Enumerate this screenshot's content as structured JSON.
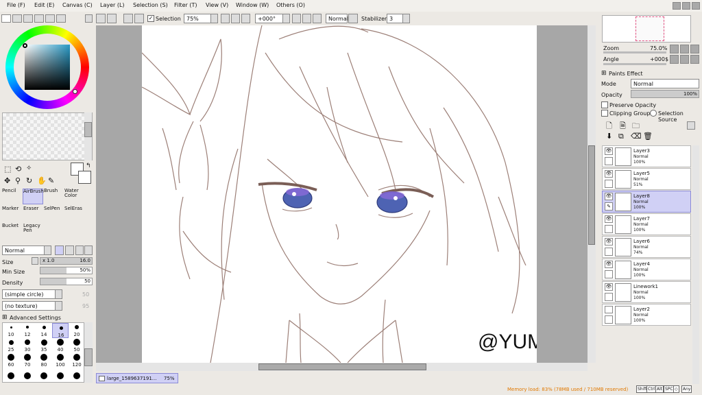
{
  "menu": [
    "File (F)",
    "Edit (E)",
    "Canvas (C)",
    "Layer (L)",
    "Selection (S)",
    "Filter (T)",
    "View (V)",
    "Window (W)",
    "Others (O)"
  ],
  "toolbar": {
    "selection_label": "Selection",
    "zoom": "75%",
    "angle": "+000°",
    "blend_mode": "Normal",
    "stabilizer_label": "Stabilizer",
    "stabilizer_value": "3"
  },
  "tools": [
    {
      "label": "Pencil"
    },
    {
      "label": "AirBrush"
    },
    {
      "label": "Brush"
    },
    {
      "label": "Water Color"
    },
    {
      "label": "Marker"
    },
    {
      "label": "Eraser"
    },
    {
      "label": "SelPen"
    },
    {
      "label": "SelEras"
    },
    {
      "label": "Bucket"
    },
    {
      "label": "Legacy Pen"
    }
  ],
  "brush": {
    "mode": "Normal",
    "size_label": "Size",
    "size_mult": "x 1.0",
    "size_value": "16.0",
    "min_size_label": "Min Size",
    "min_size_value": "50%",
    "density_label": "Density",
    "density_value": "50",
    "shape": "(simple circle)",
    "shape_value": "50",
    "texture": "(no texture)",
    "texture_value": "95",
    "advanced_label": "Advanced Settings",
    "sizes": [
      "10",
      "12",
      "14",
      "16",
      "20",
      "25",
      "30",
      "35",
      "40",
      "50",
      "60",
      "70",
      "80",
      "100",
      "120"
    ]
  },
  "canvas": {
    "watermark": "@YUMMIE",
    "tab_name": "large_1589637191...",
    "tab_zoom": "75%"
  },
  "navigator": {
    "zoom_label": "Zoom",
    "zoom_value": "75.0%",
    "angle_label": "Angle",
    "angle_value": "+000$"
  },
  "layer_panel": {
    "paints_effect": "Paints Effect",
    "mode_label": "Mode",
    "mode_value": "Normal",
    "opacity_label": "Opacity",
    "opacity_value": "100%",
    "preserve_opacity": "Preserve Opacity",
    "clipping_group": "Clipping Group",
    "selection_source": "Selection Source"
  },
  "layers": [
    {
      "name": "Layer3",
      "mode": "Normal",
      "opacity": "100%",
      "visible": true,
      "selected": false
    },
    {
      "name": "Layer5",
      "mode": "Normal",
      "opacity": "51%",
      "visible": true,
      "selected": false
    },
    {
      "name": "Layer8",
      "mode": "Normal",
      "opacity": "100%",
      "visible": true,
      "selected": true
    },
    {
      "name": "Layer7",
      "mode": "Normal",
      "opacity": "100%",
      "visible": true,
      "selected": false
    },
    {
      "name": "Layer6",
      "mode": "Normal",
      "opacity": "74%",
      "visible": true,
      "selected": false
    },
    {
      "name": "Layer4",
      "mode": "Normal",
      "opacity": "100%",
      "visible": true,
      "selected": false
    },
    {
      "name": "Linework1",
      "mode": "Normal",
      "opacity": "100%",
      "visible": true,
      "selected": false
    },
    {
      "name": "Layer2",
      "mode": "Normal",
      "opacity": "100%",
      "visible": false,
      "selected": false
    }
  ],
  "status": {
    "memory": "Memory load: 83% (78MB used / 710MB reserved)",
    "keys": [
      "Shift",
      "Ctrl",
      "Alt",
      "SPC",
      "◇",
      "Any"
    ]
  },
  "colors": {
    "accent": "#8a8ad6",
    "status_text": "#e07800"
  }
}
